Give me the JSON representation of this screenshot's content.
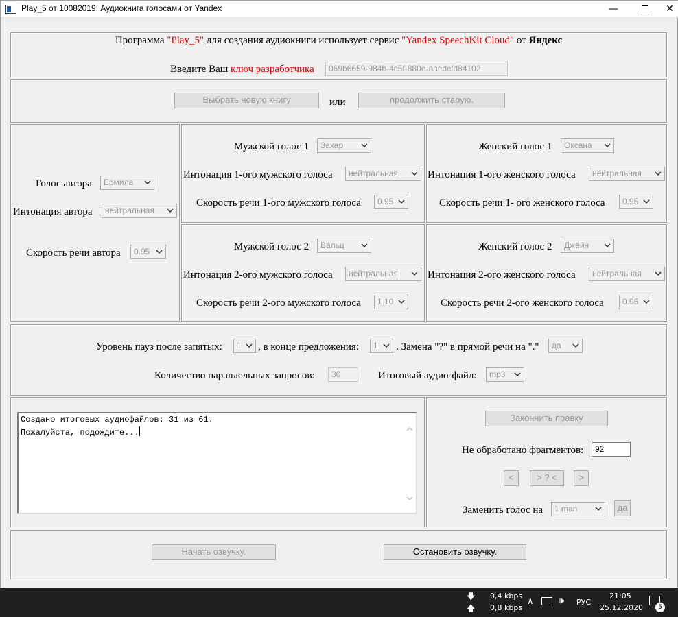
{
  "window": {
    "title": "Play_5 от 10082019: Аудиокнига голосами от Yandex",
    "minimize": "—",
    "close": "✕"
  },
  "header": {
    "line_prefix": "Программа ",
    "program_name": "\"Play_5\"",
    "line_mid": " для создания аудиокниги использует сервис ",
    "service_name": "\"Yandex SpeechKit Cloud\"",
    "line_ot": " от ",
    "company": "Яндекс",
    "key_prefix": "Введите Ваш ",
    "key_label": "ключ разработчика",
    "api_key": "069b6659-984b-4c5f-880e-aaedcfd84102"
  },
  "book": {
    "choose_new": "Выбрать новую книгу",
    "or": "или",
    "continue_old": "продолжить  старую."
  },
  "author": {
    "voice_label": "Голос автора",
    "voice": "Ермила",
    "intonation_label": "Интонация автора",
    "intonation": "нейтральная",
    "speed_label": "Скорость речи автора",
    "speed": "0.95"
  },
  "male1": {
    "voice_label": "Мужской голос 1",
    "voice": "Захар",
    "intonation_label": "Интонация 1-ого мужского голоса",
    "intonation": "нейтральная",
    "speed_label": "Скорость речи 1-ого мужского голоса",
    "speed": "0.95"
  },
  "female1": {
    "voice_label": "Женский голос 1",
    "voice": "Оксана",
    "intonation_label": "Интонация 1-ого женского голоса",
    "intonation": "нейтральная",
    "speed_label": "Скорость речи 1- ого женского голоса",
    "speed": "0.95"
  },
  "male2": {
    "voice_label": "Мужской голос 2",
    "voice": "Вальц",
    "intonation_label": "Интонация 2-ого мужского голоса",
    "intonation": "нейтральная",
    "speed_label": "Скорость речи 2-ого мужского голоса",
    "speed": "1.10"
  },
  "female2": {
    "voice_label": "Женский голос 2",
    "voice": "Джейн",
    "intonation_label": "Интонация 2-ого женского голоса",
    "intonation": "нейтральная",
    "speed_label": "Скорость речи 2-ого женского голоса",
    "speed": "0.95"
  },
  "pauses": {
    "comma_label": "Уровень пауз после запятых:",
    "comma_value": "1",
    "sentence_label": ", в конце предложения:",
    "sentence_value": "1",
    "replace_label": ". Замена \"?\" в прямой речи на \".\"",
    "replace_value": "да",
    "parallel_label": "Количество параллельных запросов:",
    "parallel_value": "30",
    "output_label": "Итоговый аудио-файл:",
    "output_value": "mp3"
  },
  "log": {
    "line1": "Создано итоговых аудиофайлов: 31 из 61.",
    "line2": "Пожалуйста, подождите..."
  },
  "edit": {
    "finish_button": "Закончить правку",
    "unprocessed_label": "Не обработано фрагментов:",
    "unprocessed_value": "92",
    "prev": "<",
    "middle": "> ? <",
    "next": ">",
    "replace_label": "Заменить голос на",
    "replace_value": "1 man",
    "replace_confirm": "да"
  },
  "actions": {
    "start": "Начать озвучку.",
    "stop": "Остановить озвучку."
  },
  "taskbar": {
    "down_speed": "0,4 kbps",
    "up_speed": "0,8 kbps",
    "lang": "РУС",
    "time": "21:05",
    "date": "25.12.2020",
    "notif_count": "5"
  }
}
